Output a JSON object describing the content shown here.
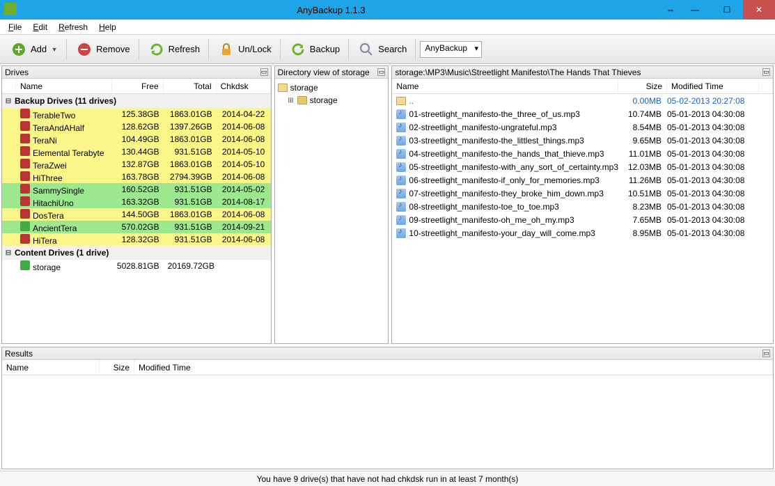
{
  "title": "AnyBackup 1.1.3",
  "menu": {
    "file": "File",
    "edit": "Edit",
    "refresh": "Refresh",
    "help": "Help"
  },
  "toolbar": {
    "add": "Add",
    "remove": "Remove",
    "refresh": "Refresh",
    "unlock": "Un/Lock",
    "backup": "Backup",
    "search": "Search",
    "mode": "AnyBackup"
  },
  "panels": {
    "drives_title": "Drives",
    "dir_title": "Directory view of storage",
    "path_title": "storage:\\MP3\\Music\\Streetlight Manifesto\\The Hands That Thieves",
    "results_title": "Results"
  },
  "drives_headers": {
    "name": "Name",
    "free": "Free",
    "total": "Total",
    "chkdsk": "Chkdsk"
  },
  "drives": {
    "group1": "Backup Drives (11 drives)",
    "rows": [
      {
        "name": "TerableTwo",
        "free": "125.38GB",
        "total": "1863.01GB",
        "chk": "2014-04-22",
        "cls": "row-y",
        "ic": "drv-r"
      },
      {
        "name": "TeraAndAHalf",
        "free": "128.62GB",
        "total": "1397.26GB",
        "chk": "2014-06-08",
        "cls": "row-y",
        "ic": "drv-r"
      },
      {
        "name": "TeraNi",
        "free": "104.49GB",
        "total": "1863.01GB",
        "chk": "2014-06-08",
        "cls": "row-y",
        "ic": "drv-r"
      },
      {
        "name": "Elemental Terabyte",
        "free": "130.44GB",
        "total": "931.51GB",
        "chk": "2014-05-10",
        "cls": "row-y",
        "ic": "drv-r"
      },
      {
        "name": "TeraZwei",
        "free": "132.87GB",
        "total": "1863.01GB",
        "chk": "2014-05-10",
        "cls": "row-y",
        "ic": "drv-r"
      },
      {
        "name": "HiThree",
        "free": "163.78GB",
        "total": "2794.39GB",
        "chk": "2014-06-08",
        "cls": "row-y",
        "ic": "drv-r"
      },
      {
        "name": "SammySingle",
        "free": "160.52GB",
        "total": "931.51GB",
        "chk": "2014-05-02",
        "cls": "row-g",
        "ic": "drv-r"
      },
      {
        "name": "HitachiUno",
        "free": "163.32GB",
        "total": "931.51GB",
        "chk": "2014-08-17",
        "cls": "row-g",
        "ic": "drv-r"
      },
      {
        "name": "DosTera",
        "free": "144.50GB",
        "total": "1863.01GB",
        "chk": "2014-06-08",
        "cls": "row-y",
        "ic": "drv-r"
      },
      {
        "name": "AncientTera",
        "free": "570.02GB",
        "total": "931.51GB",
        "chk": "2014-09-21",
        "cls": "row-g",
        "ic": "drv-g"
      },
      {
        "name": "HiTera",
        "free": "128.32GB",
        "total": "931.51GB",
        "chk": "2014-06-08",
        "cls": "row-y",
        "ic": "drv-r"
      }
    ],
    "group2": "Content Drives (1 drive)",
    "rows2": [
      {
        "name": "storage",
        "free": "5028.81GB",
        "total": "20169.72GB",
        "chk": "",
        "cls": "",
        "ic": "drv-g"
      }
    ]
  },
  "tree": {
    "root": "storage",
    "child": "storage"
  },
  "files_headers": {
    "name": "Name",
    "size": "Size",
    "mod": "Modified Time"
  },
  "parent": {
    "name": "..",
    "size": "0.00MB",
    "mod": "05-02-2013 20:27:08"
  },
  "files": [
    {
      "name": "01-streetlight_manifesto-the_three_of_us.mp3",
      "size": "10.74MB",
      "mod": "05-01-2013 04:30:08"
    },
    {
      "name": "02-streetlight_manifesto-ungrateful.mp3",
      "size": "8.54MB",
      "mod": "05-01-2013 04:30:08"
    },
    {
      "name": "03-streetlight_manifesto-the_littlest_things.mp3",
      "size": "9.65MB",
      "mod": "05-01-2013 04:30:08"
    },
    {
      "name": "04-streetlight_manifesto-the_hands_that_thieve.mp3",
      "size": "11.01MB",
      "mod": "05-01-2013 04:30:08"
    },
    {
      "name": "05-streetlight_manifesto-with_any_sort_of_certainty.mp3",
      "size": "12.03MB",
      "mod": "05-01-2013 04:30:08"
    },
    {
      "name": "06-streetlight_manifesto-if_only_for_memories.mp3",
      "size": "11.26MB",
      "mod": "05-01-2013 04:30:08"
    },
    {
      "name": "07-streetlight_manifesto-they_broke_him_down.mp3",
      "size": "10.51MB",
      "mod": "05-01-2013 04:30:08"
    },
    {
      "name": "08-streetlight_manifesto-toe_to_toe.mp3",
      "size": "8.23MB",
      "mod": "05-01-2013 04:30:08"
    },
    {
      "name": "09-streetlight_manifesto-oh_me_oh_my.mp3",
      "size": "7.65MB",
      "mod": "05-01-2013 04:30:08"
    },
    {
      "name": "10-streetlight_manifesto-your_day_will_come.mp3",
      "size": "8.95MB",
      "mod": "05-01-2013 04:30:08"
    }
  ],
  "results_headers": {
    "name": "Name",
    "size": "Size",
    "mod": "Modified Time"
  },
  "status": "You have 9 drive(s) that have not had chkdsk run in at least 7 month(s)"
}
